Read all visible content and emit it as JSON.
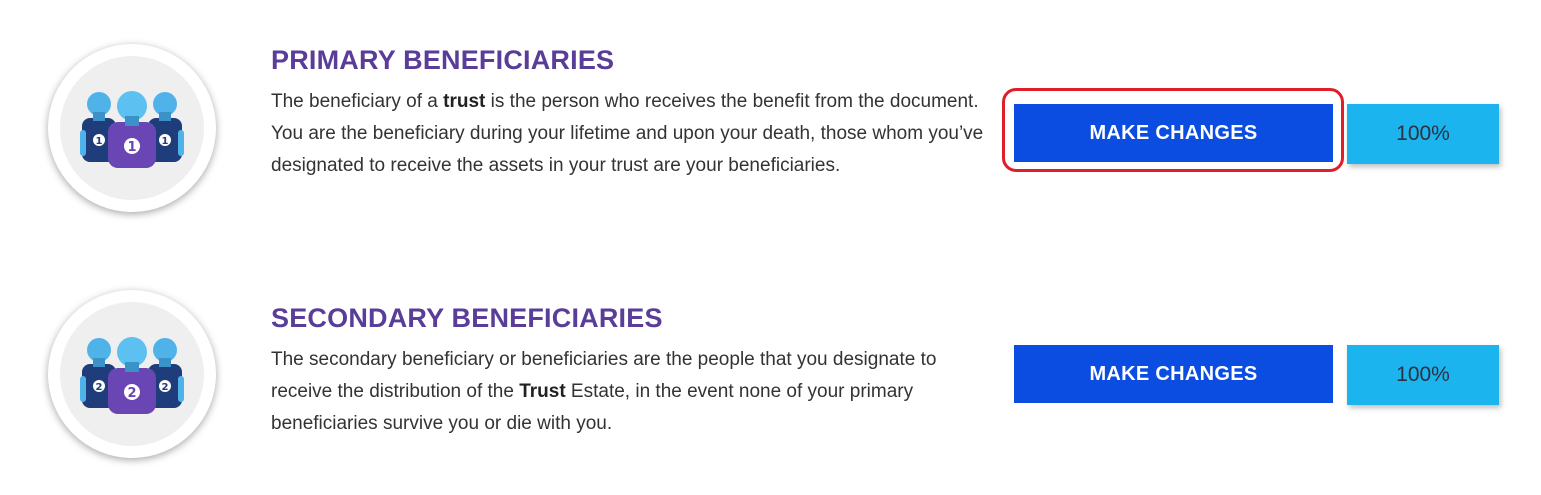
{
  "primary": {
    "title": "PRIMARY BENEFICIARIES",
    "desc": {
      "part1": "The beneficiary of a ",
      "bold": "trust",
      "part2": " is the person who receives the benefit from the document. You are the beneficiary during your lifetime and upon your death, those whom you’ve designated to receive the assets in your trust are your beneficiaries."
    },
    "badge_number": "1",
    "button_label": "MAKE CHANGES",
    "percentage": "100%",
    "icon": "group-people-icon"
  },
  "secondary": {
    "title": "SECONDARY BENEFICIARIES",
    "desc": {
      "part1": "The secondary beneficiary or beneficiaries are the people that you designate to receive the distribution of the ",
      "bold": "Trust",
      "part2": " Estate, in the event none of your primary beneficiaries survive you or die with you."
    },
    "badge_number": "2",
    "button_label": "MAKE CHANGES",
    "percentage": "100%",
    "icon": "group-people-icon"
  },
  "colors": {
    "title": "#5a3d99",
    "button": "#0a4de0",
    "percentage_bg": "#1bb4ee",
    "highlight": "#e01e2a"
  }
}
